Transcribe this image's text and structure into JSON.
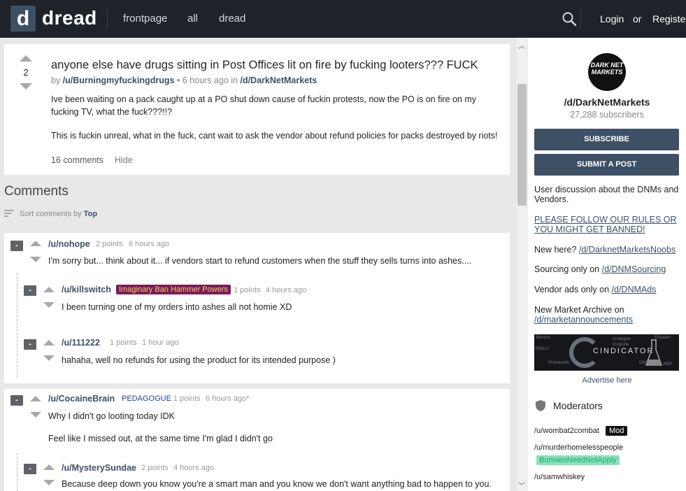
{
  "header": {
    "logo_letter": "d",
    "logo_text": "dread",
    "nav": [
      "frontpage",
      "all",
      "dread"
    ],
    "login": "Login",
    "or": "or",
    "register": "Register"
  },
  "post": {
    "score": "2",
    "title": "anyone else have drugs sitting in Post Offices lit on fire by fucking looters??? FUCK",
    "by": "by",
    "author": "/u/Burningmyfuckingdrugs",
    "time": "• 6 hours ago in",
    "sub": "/d/DarkNetMarkets",
    "body1": "Ive been waiting on a pack caught up at a PO shut down cause of fuckin protests, now the PO is on fire on my fucking TV, what the fuck???!!?",
    "body2": "This is fuckin unreal, what in the fuck, cant wait to ask the vendor about refund policies for packs destroyed by riots!",
    "comments_link": "16 comments",
    "hide_link": "Hide"
  },
  "comments_section": {
    "title": "Comments",
    "sort_prefix": "Sort comments by",
    "sort_value": "Top"
  },
  "comments": [
    {
      "collapse": "-",
      "user": "/u/nohope",
      "points": "2 points",
      "time": "6 hours ago",
      "text": "I'm sorry but... think about it... if vendors start to refund customers when the stuff they sells turns into ashes...."
    },
    {
      "collapse": "-",
      "user": "/u/killswitch",
      "flair": "Imaginary Ban Hammer Powers",
      "points": "1 points",
      "time": "4 hours ago",
      "text": "I been turning one of my orders into ashes all not homie XD"
    },
    {
      "collapse": "-",
      "user": "/u/111222",
      "points": "1 points",
      "time": "1 hour ago",
      "text": "hahaha, well no refunds for using the product for its intended purpose )"
    },
    {
      "collapse": "-",
      "user": "/u/CocaineBrain",
      "flair": "PEDAGOGUE",
      "points": "1 points",
      "time": "6 hours ago*",
      "text": "Why I didn't go looting today IDK",
      "text2": "Feel like I missed out, at the same time I'm glad I didn't go"
    },
    {
      "collapse": "-",
      "user": "/u/MysterySundae",
      "points": "2 points",
      "time": "4 hours ago",
      "text": "Because deep down you know you're a smart man and you know we don't want anything bad to happen to you."
    }
  ],
  "sidebar": {
    "logo_text": "DARK NET MARKETS",
    "name": "/d/DarkNetMarkets",
    "subscribers": "27,288 subscribers",
    "subscribe": "SUBSCRIBE",
    "submit": "SUBMIT A POST",
    "description": "User discussion about the DNMs and Vendors.",
    "rules_link": "PLEASE FOLLOW OUR RULES OR YOU MIGHT GET BANNED!",
    "new_here_label": "New here?",
    "new_here_link": "/d/DarknetMarketsNoobs",
    "sourcing_label": "Sourcing only on",
    "sourcing_link": "/d/DNMSourcing",
    "vendor_label": "Vendor ads only on",
    "vendor_link": "/d/DNMAds",
    "archive_label": "New Market Archive on",
    "archive_link": "/d/marketannouncements",
    "ad_title": "CINDICATOR",
    "ad_words": [
      "Benzos",
      "Analogue",
      "Etizolam",
      "MOLLY",
      "Eutylone",
      "Phenacetin",
      "DMT",
      "NEP"
    ],
    "advertise": "Advertise here",
    "moderators_title": "Moderators",
    "moderators": [
      {
        "name": "/u/wombat2combat",
        "badge": "Mod"
      },
      {
        "name": "/u/murderhomelesspeople",
        "flair": "BunniesNeedNotApply"
      },
      {
        "name": "/u/samwhiskey"
      }
    ]
  }
}
